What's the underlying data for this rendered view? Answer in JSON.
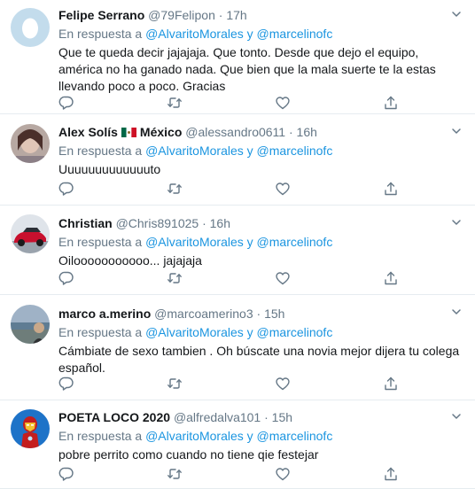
{
  "tweets": [
    {
      "name": "Felipe Serrano",
      "flag": "",
      "country": "",
      "handle": "@79Felipon",
      "time": "17h",
      "reply_prefix": "En respuesta a",
      "reply_user1": "@AlvaritoMorales",
      "reply_and": "y",
      "reply_user2": "@marcelinofc",
      "text": "Que te queda decir jajajaja. Que tonto. Desde que dejo el equipo, américa no ha ganado nada. Que bien que la mala suerte te la estas llevando poco a poco. Gracias",
      "avatar": "egg-avatar"
    },
    {
      "name": "Alex Solís",
      "flag": "mexico-flag",
      "country": "México",
      "handle": "@alessandro0611",
      "time": "16h",
      "reply_prefix": "En respuesta a",
      "reply_user1": "@AlvaritoMorales",
      "reply_and": "y",
      "reply_user2": "@marcelinofc",
      "text": "Uuuuuuuuuuuuuto",
      "avatar": "photo-avatar"
    },
    {
      "name": "Christian",
      "flag": "",
      "country": "",
      "handle": "@Chris891025",
      "time": "16h",
      "reply_prefix": "En respuesta a",
      "reply_user1": "@AlvaritoMorales",
      "reply_and": "y",
      "reply_user2": "@marcelinofc",
      "text": "Oilooooooooooo... jajajaja",
      "avatar": "car-avatar"
    },
    {
      "name": "marco a.merino",
      "flag": "",
      "country": "",
      "handle": "@marcoamerino3",
      "time": "15h",
      "reply_prefix": "En respuesta a",
      "reply_user1": "@AlvaritoMorales",
      "reply_and": "y",
      "reply_user2": "@marcelinofc",
      "text": "Cámbiate de sexo tambien . Oh búscate una novia mejor dijera tu colega español.",
      "avatar": "beach-avatar"
    },
    {
      "name": "POETA LOCO 2020",
      "flag": "",
      "country": "",
      "handle": "@alfredalva101",
      "time": "15h",
      "reply_prefix": "En respuesta a",
      "reply_user1": "@AlvaritoMorales",
      "reply_and": "y",
      "reply_user2": "@marcelinofc",
      "text": "pobre perrito como cuando no tiene qie festejar",
      "avatar": "ironman-avatar"
    }
  ],
  "dot": "·",
  "colors": {
    "link": "#1b95e0",
    "muted": "#657786",
    "text": "#14171a",
    "divider": "#e6ecf0"
  },
  "icons": [
    "reply-icon",
    "retweet-icon",
    "like-icon",
    "share-icon",
    "caret-down-icon"
  ]
}
